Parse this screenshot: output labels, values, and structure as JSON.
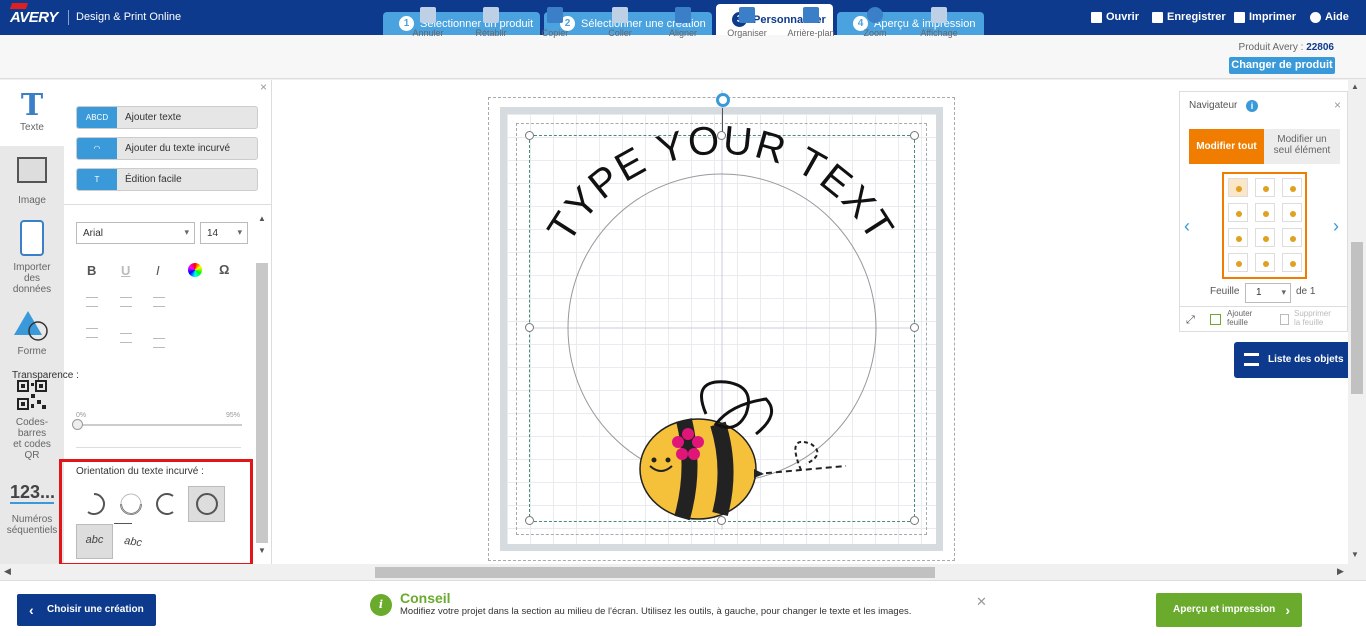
{
  "app": {
    "logo": "AVERY",
    "brand": "Design & Print Online"
  },
  "steps": [
    {
      "num": "1",
      "label": "Sélectionner un produit"
    },
    {
      "num": "2",
      "label": "Sélectionner une création"
    },
    {
      "num": "3",
      "label": "Personnaliser"
    },
    {
      "num": "4",
      "label": "Aperçu & impression"
    }
  ],
  "top_actions": {
    "open": "Ouvrir",
    "save": "Enregistrer",
    "print": "Imprimer",
    "help": "Aide"
  },
  "toolbar": {
    "undo": "Annuler",
    "redo": "Rétablir",
    "copy": "Copier",
    "paste": "Coller",
    "align": "Aligner",
    "arrange": "Organiser",
    "background": "Arrière-plan",
    "zoom": "Zoom",
    "display": "Affichage"
  },
  "product": {
    "label": "Produit Avery :",
    "number": "22806",
    "change": "Changer de produit"
  },
  "sidebar": {
    "text": "Texte",
    "image": "Image",
    "import_l1": "Importer",
    "import_l2": "des",
    "import_l3": "données",
    "shape": "Forme",
    "codes_l1": "Codes-",
    "codes_l2": "barres",
    "codes_l3": "et codes",
    "codes_l4": "QR",
    "seq_number": "123...",
    "seq_l1": "Numéros",
    "seq_l2": "séquentiels"
  },
  "text_panel": {
    "add_text": "Ajouter texte",
    "add_text_icon": "ABCD",
    "add_curved": "Ajouter du texte incurvé",
    "easy_edit": "Édition facile",
    "font": "Arial",
    "size": "14",
    "bold": "B",
    "underline": "U",
    "italic": "I",
    "omega": "Ω",
    "transparency": "Transparence :",
    "min": "0%",
    "max": "95%",
    "transparency_value": 0,
    "curve_orientation": "Orientation du texte incurvé :",
    "abc1": "abc",
    "abc2": "abc"
  },
  "canvas": {
    "curved_text": "TYPE YOUR TEXT"
  },
  "navigator": {
    "title": "Navigateur",
    "edit_all": "Modifier tout",
    "edit_one_l1": "Modifier un",
    "edit_one_l2": "seul élément",
    "sheet": "Feuille",
    "sheet_value": "1",
    "of": "de 1",
    "add_sheet_l1": "Ajouter",
    "add_sheet_l2": "feuille",
    "delete_sheet_l1": "Supprimer",
    "delete_sheet_l2": "la feuille"
  },
  "objects_list": "Liste des objets",
  "footer": {
    "choose": "Choisir une création",
    "tip_title": "Conseil",
    "tip_text": "Modifiez votre projet dans la section au milieu de l'écran. Utilisez les outils, à gauche, pour changer le texte et les images.",
    "preview": "Aperçu et impression"
  },
  "colors": {
    "navy": "#0d3a8c",
    "tab": "#4aa3df",
    "orange": "#f07c00",
    "green": "#6aab2e",
    "highlight": "#e0161b"
  }
}
